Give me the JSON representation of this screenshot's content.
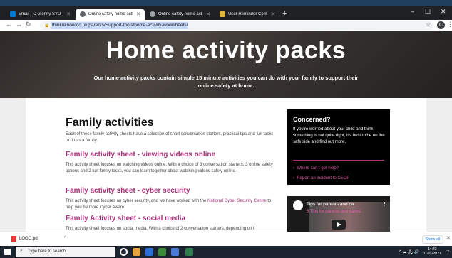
{
  "browser": {
    "tabs": [
      {
        "label": "Email - C Glenny SYD - Outlook",
        "active": false,
        "fav_color": "#0078d4"
      },
      {
        "label": "Online safety home activity work",
        "active": true,
        "fav_color": "#5f6368"
      },
      {
        "label": "Online safety home activity work",
        "active": false,
        "fav_color": "#5f6368"
      },
      {
        "label": "User Reminder Completion",
        "active": false,
        "fav_color": "#e2b33c"
      }
    ],
    "new_tab": "+",
    "window_controls": [
      "–",
      "☐",
      "✕"
    ],
    "url": "thinkuknow.co.uk/parents/Support-tools/home-activity-worksheets/",
    "profile_initial": "C"
  },
  "hero": {
    "title": "Home activity packs",
    "subtitle": "Our home activity packs contain simple 15 minute activities you can do with your family to support their online safety at home."
  },
  "main": {
    "heading": "Family activities",
    "intro": "Each of these family activity sheets have a selection of short conversation starters, practical tips and fun tasks to do as a family.",
    "sheets": [
      {
        "title": "Family activity sheet - viewing videos online",
        "text": "This activity sheet focuses on watching videos online. With a choice of 3 conversation starters, 3 online safety actions and 2 fun family tasks, you can learn together about watching videos safely online."
      },
      {
        "title": "Family activity sheet - cyber security",
        "text_before": "This activity sheet focuses on cyber security, and we have worked with the ",
        "link": "National Cyber Security Centre",
        "text_after": " to help you be more Cyber Aware."
      },
      {
        "title": "Family Activity sheet - social media",
        "text": "This activity sheet focuses on social media. With a choice of 2 conversation starters, depending on if"
      }
    ]
  },
  "sidebar": {
    "concerned_title": "Concerned?",
    "concerned_text": "If you're worried about your child and think something is not quite right, it's best to be on the safe side and find out more.",
    "links": [
      "Where can I get help?",
      "Report an incident to CEOP"
    ],
    "video_title": "Tips for parents and ca...",
    "video_subtitle": "5 Tips for parents and carers"
  },
  "downloads": {
    "file_name": "LOGO.pdf",
    "show_all": "Show all"
  },
  "taskbar": {
    "search_placeholder": "Type here to search",
    "time": "14:43",
    "date": "11/01/2021"
  }
}
